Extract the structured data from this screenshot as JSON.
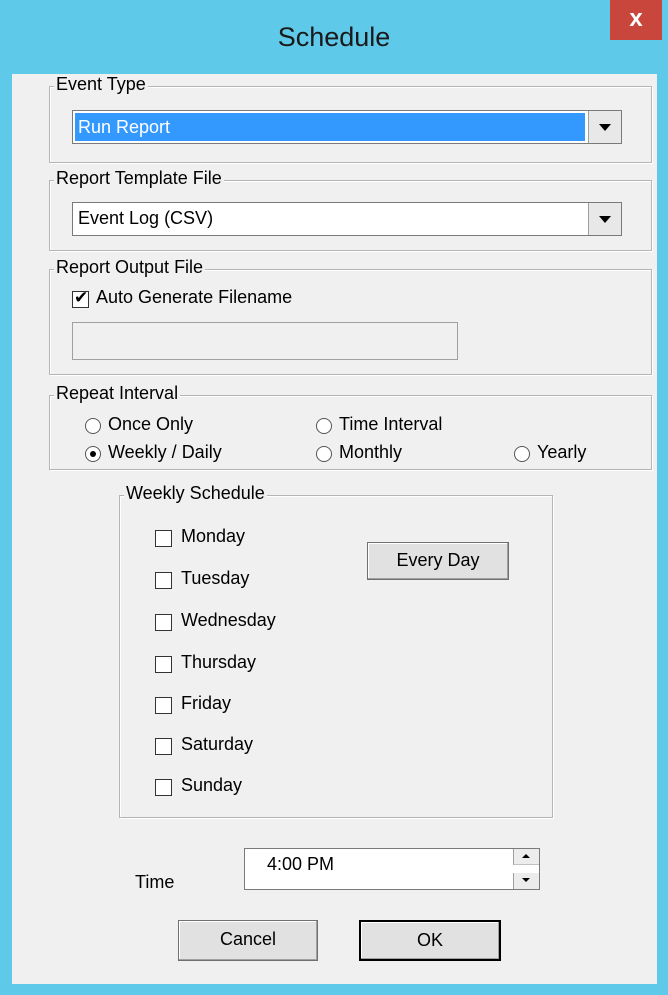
{
  "window": {
    "title": "Schedule",
    "close_glyph": "x"
  },
  "event_type": {
    "legend": "Event Type",
    "selected": "Run Report"
  },
  "report_template": {
    "legend": "Report Template File",
    "selected": "Event Log (CSV)"
  },
  "report_output": {
    "legend": "Report Output File",
    "auto_label": "Auto Generate Filename",
    "auto_checked": true,
    "filename": ""
  },
  "repeat": {
    "legend": "Repeat Interval",
    "options": [
      {
        "label": "Once Only",
        "checked": false
      },
      {
        "label": "Time Interval",
        "checked": false
      },
      {
        "label": "Weekly / Daily",
        "checked": true
      },
      {
        "label": "Monthly",
        "checked": false
      },
      {
        "label": "Yearly",
        "checked": false
      }
    ]
  },
  "weekly": {
    "legend": "Weekly Schedule",
    "every_day_label": "Every Day",
    "days": [
      {
        "label": "Monday",
        "checked": false
      },
      {
        "label": "Tuesday",
        "checked": false
      },
      {
        "label": "Wednesday",
        "checked": false
      },
      {
        "label": "Thursday",
        "checked": false
      },
      {
        "label": "Friday",
        "checked": false
      },
      {
        "label": "Saturday",
        "checked": false
      },
      {
        "label": "Sunday",
        "checked": false
      }
    ]
  },
  "time": {
    "label": "Time",
    "value": "4:00 PM"
  },
  "buttons": {
    "cancel": "Cancel",
    "ok": "OK"
  },
  "colors": {
    "titlebar": "#5fc9ea",
    "close": "#c9463d",
    "selection": "#3399ff",
    "client": "#f0f0f0"
  }
}
